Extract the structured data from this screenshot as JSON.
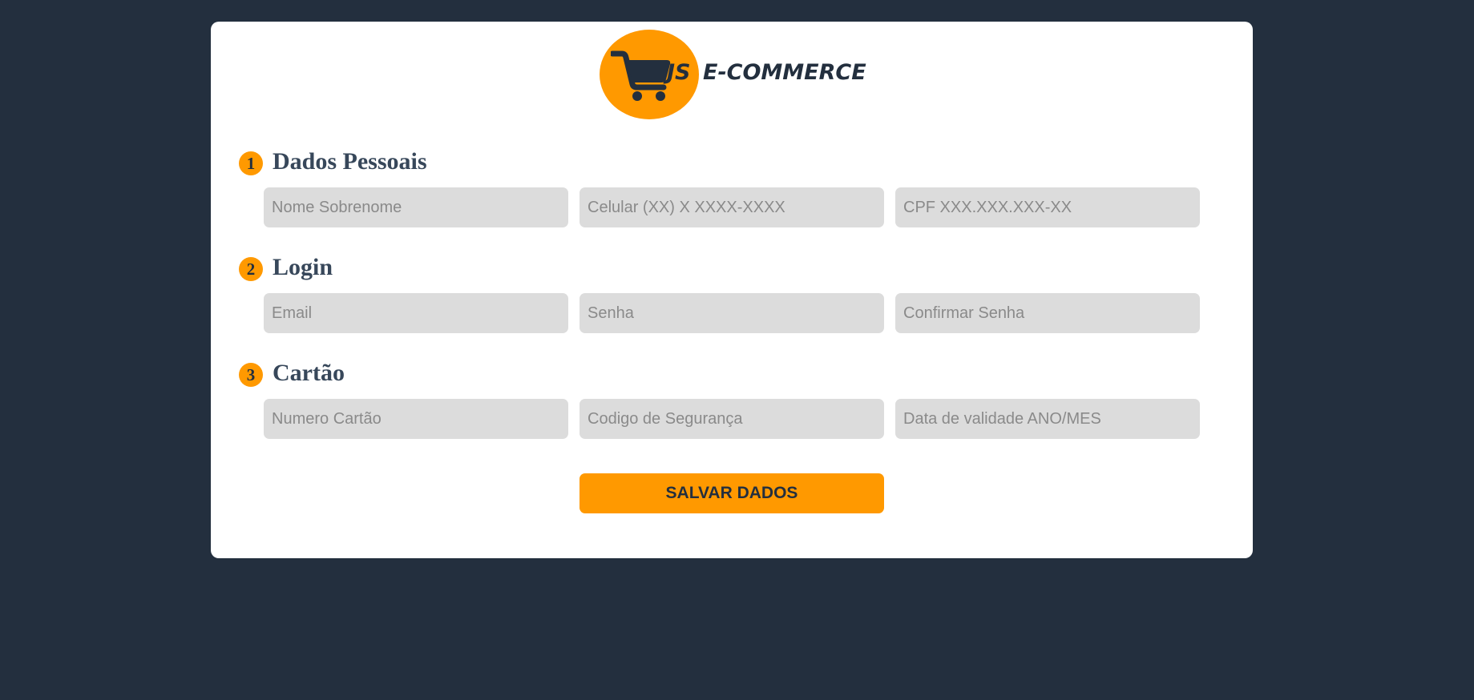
{
  "brand": {
    "logo_js": "JS",
    "logo_name": "E-COMMERCE",
    "accent_color": "#ff9900",
    "dark_color": "#232f3e"
  },
  "sections": [
    {
      "number": "1",
      "title": "Dados Pessoais",
      "fields": [
        {
          "placeholder": "Nome Sobrenome",
          "value": ""
        },
        {
          "placeholder": "Celular (XX) X XXXX-XXXX",
          "value": ""
        },
        {
          "placeholder": "CPF XXX.XXX.XXX-XX",
          "value": ""
        }
      ]
    },
    {
      "number": "2",
      "title": "Login",
      "fields": [
        {
          "placeholder": "Email",
          "value": ""
        },
        {
          "placeholder": "Senha",
          "value": ""
        },
        {
          "placeholder": "Confirmar Senha",
          "value": ""
        }
      ]
    },
    {
      "number": "3",
      "title": "Cartão",
      "fields": [
        {
          "placeholder": "Numero Cartão",
          "value": ""
        },
        {
          "placeholder": "Codigo de Segurança",
          "value": ""
        },
        {
          "placeholder": "Data de validade ANO/MES",
          "value": ""
        }
      ]
    }
  ],
  "submit": {
    "label": "SALVAR DADOS"
  },
  "icons": {
    "logo": "shopping-cart-icon"
  }
}
